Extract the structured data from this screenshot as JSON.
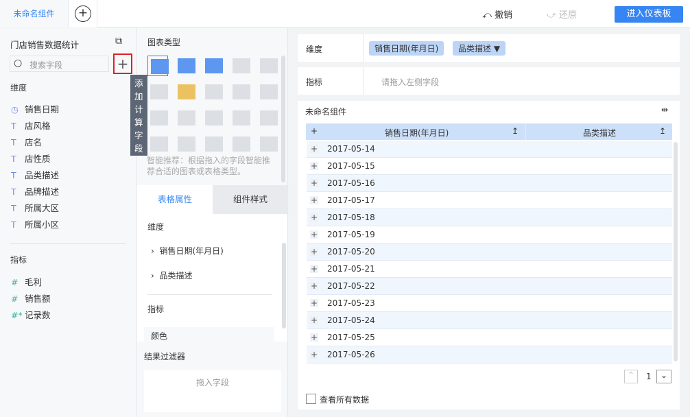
{
  "top": {
    "tab": "未命名组件",
    "undo": "撤销",
    "redo": "还原",
    "enter": "进入仪表板"
  },
  "left": {
    "dataset": "门店销售数据统计",
    "search_placeholder": "搜索字段",
    "tooltip": "添加计算字段",
    "dim_title": "维度",
    "dims": [
      {
        "icon": "clock",
        "label": "销售日期"
      },
      {
        "icon": "T",
        "label": "店风格"
      },
      {
        "icon": "T",
        "label": "店名"
      },
      {
        "icon": "T",
        "label": "店性质"
      },
      {
        "icon": "T",
        "label": "品类描述"
      },
      {
        "icon": "T",
        "label": "品牌描述"
      },
      {
        "icon": "T",
        "label": "所属大区"
      },
      {
        "icon": "T",
        "label": "所属小区"
      }
    ],
    "measure_title": "指标",
    "measures": [
      {
        "icon": "#",
        "label": "毛利"
      },
      {
        "icon": "#",
        "label": "销售额"
      },
      {
        "icon": "#*",
        "label": "记录数"
      }
    ]
  },
  "mid": {
    "chart_type_title": "图表类型",
    "hint": "智能推荐：根据拖入的字段智能推荐合适的图表或表格类型。",
    "tab_table": "表格属性",
    "tab_style": "组件样式",
    "dim": "维度",
    "dim_items": [
      "销售日期(年月日)",
      "品类描述"
    ],
    "measure": "指标",
    "color": "颜色",
    "filter_title": "结果过滤器",
    "filter_drop": "拖入字段"
  },
  "right": {
    "dim_label": "维度",
    "dim_tags": [
      "销售日期(年月日)",
      "品类描述"
    ],
    "measure_label": "指标",
    "measure_placeholder": "请拖入左侧字段",
    "widget_title": "未命名组件",
    "columns": [
      "销售日期(年月日)",
      "品类描述"
    ],
    "rows": [
      "2017-05-14",
      "2017-05-15",
      "2017-05-16",
      "2017-05-17",
      "2017-05-18",
      "2017-05-19",
      "2017-05-20",
      "2017-05-21",
      "2017-05-22",
      "2017-05-23",
      "2017-05-24",
      "2017-05-25",
      "2017-05-26"
    ],
    "page": "1",
    "view_all": "查看所有数据"
  },
  "colors": {
    "accent": "#3685f2",
    "header": "#cde0fa",
    "row_alt": "#f0f6fd",
    "highlight": "#e02020"
  }
}
